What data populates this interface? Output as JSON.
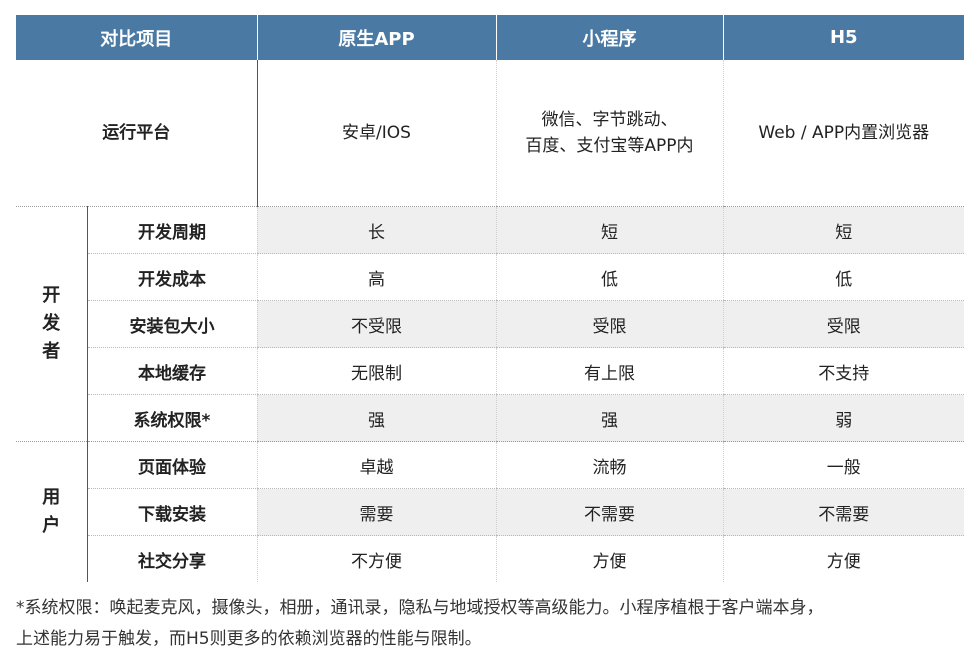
{
  "header": {
    "col0": "对比项目",
    "col1": "原生APP",
    "col2": "小程序",
    "col3": "H5"
  },
  "platform_row": {
    "label": "运行平台",
    "app": "安卓/IOS",
    "miniprogram_line1": "微信、字节跳动、",
    "miniprogram_line2": "百度、支付宝等APP内",
    "h5": "Web / APP内置浏览器"
  },
  "groups": {
    "developer": [
      "开",
      "发",
      "者"
    ],
    "user": [
      "用",
      "户"
    ]
  },
  "rows": [
    {
      "label": "开发周期",
      "app": "长",
      "miniprogram": "短",
      "h5": "短"
    },
    {
      "label": "开发成本",
      "app": "高",
      "miniprogram": "低",
      "h5": "低"
    },
    {
      "label": "安装包大小",
      "app": "不受限",
      "miniprogram": "受限",
      "h5": "受限"
    },
    {
      "label": "本地缓存",
      "app": "无限制",
      "miniprogram": "有上限",
      "h5": "不支持"
    },
    {
      "label": "系统权限*",
      "app": "强",
      "miniprogram": "强",
      "h5": "弱"
    },
    {
      "label": "页面体验",
      "app": "卓越",
      "miniprogram": "流畅",
      "h5": "一般"
    },
    {
      "label": "下载安装",
      "app": "需要",
      "miniprogram": "不需要",
      "h5": "不需要"
    },
    {
      "label": "社交分享",
      "app": "不方便",
      "miniprogram": "方便",
      "h5": "方便"
    }
  ],
  "footnote": {
    "line1": "*系统权限：唤起麦克风，摄像头，相册，通讯录，隐私与地域授权等高级能力。小程序植根于客户端本身，",
    "line2": "上述能力易于触发，而H5则更多的依赖浏览器的性能与限制。"
  },
  "colors": {
    "header_bg": "#4a7aa3",
    "shaded_row": "#efefef"
  }
}
